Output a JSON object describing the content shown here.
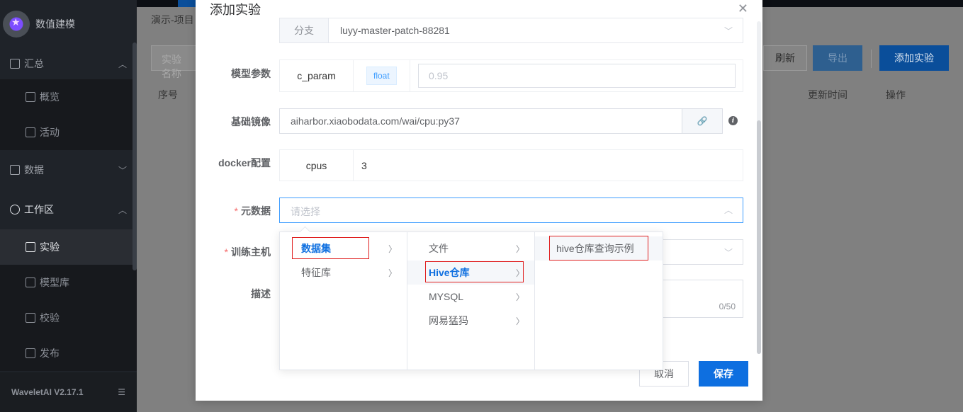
{
  "sidebar": {
    "brand": "数值建模",
    "groups": [
      {
        "label": "汇总",
        "items": [
          "概览",
          "活动"
        ]
      },
      {
        "label": "数据"
      },
      {
        "label": "工作区",
        "items": [
          "实验",
          "模型库",
          "校验",
          "发布"
        ]
      }
    ],
    "version": "WaveletAI V2.17.1"
  },
  "page": {
    "breadcrumb": "演示-项目",
    "search_placeholder": "实验名称",
    "columns": {
      "index": "序号",
      "updated": "更新时间",
      "action": "操作"
    },
    "buttons": {
      "refresh": "刷新",
      "export": "导出",
      "add": "添加实验"
    }
  },
  "dialog": {
    "title": "添加实验",
    "branch": {
      "prefix": "分支",
      "value": "luyy-master-patch-88281"
    },
    "params": {
      "label": "模型参数",
      "name": "c_param",
      "type": "float",
      "placeholder": "0.95"
    },
    "image": {
      "label": "基础镜像",
      "value": "aiharbor.xiaobodata.com/wai/cpu:py37"
    },
    "docker": {
      "label": "docker配置",
      "key": "cpus",
      "value": "3"
    },
    "metadata": {
      "label": "元数据",
      "placeholder": "请选择"
    },
    "host": {
      "label": "训练主机"
    },
    "description": {
      "label": "描述",
      "count": "0/50"
    },
    "cancel": "取消",
    "save": "保存"
  },
  "cascader": {
    "level1": [
      "数据集",
      "特征库"
    ],
    "level2": [
      "文件",
      "Hive仓库",
      "MYSQL",
      "网易猛犸"
    ],
    "level3": [
      "hive仓库查询示例"
    ]
  },
  "colors": {
    "primary": "#0e6fe0",
    "highlight": "#e02020",
    "sidebar": "#1f2329"
  }
}
